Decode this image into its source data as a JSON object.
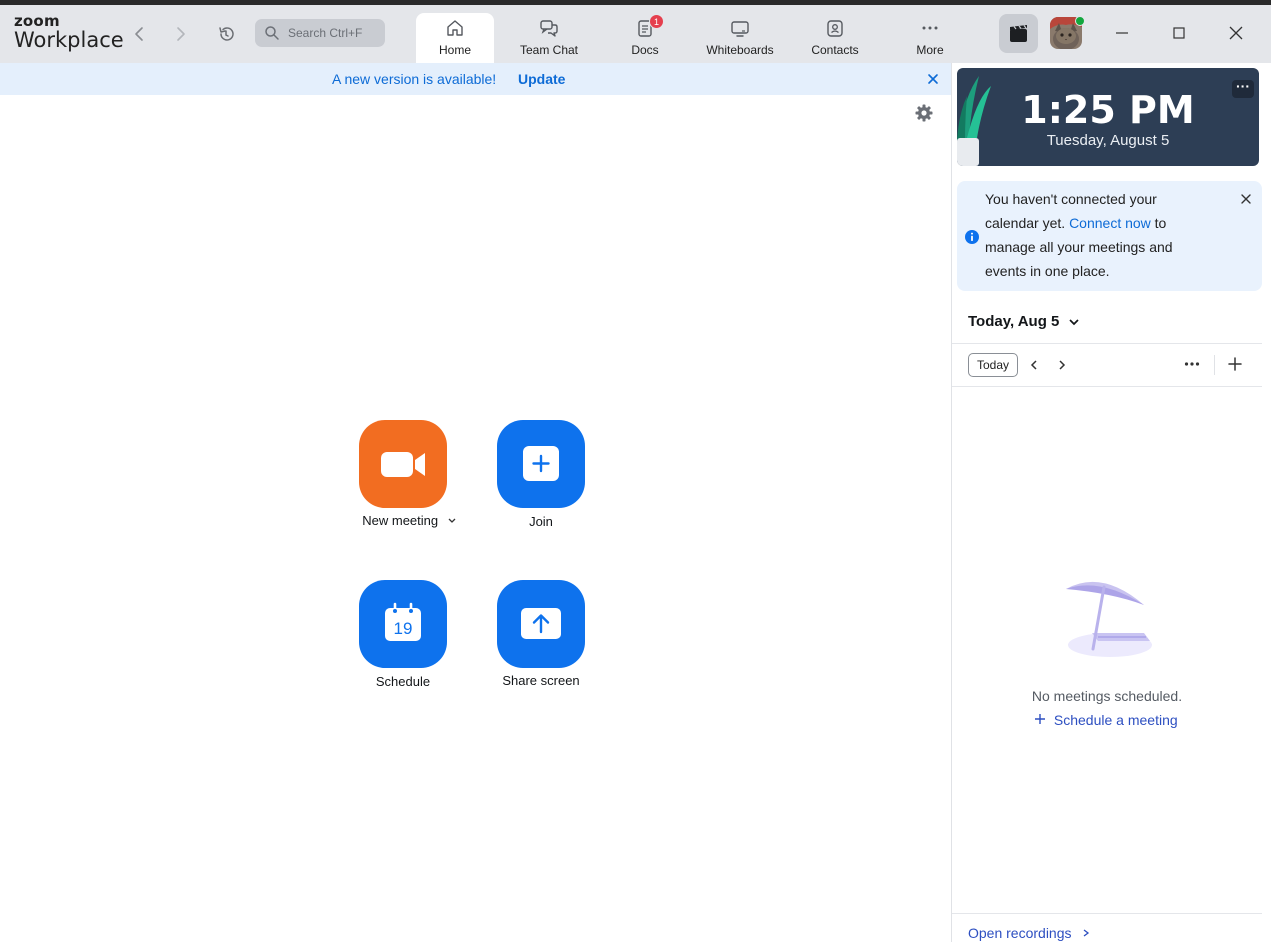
{
  "app": {
    "logo_top": "zoom",
    "logo_bottom": "Workplace"
  },
  "search": {
    "placeholder": "Search Ctrl+F"
  },
  "tabs": [
    {
      "label": "Home",
      "icon": "home-icon",
      "active": true
    },
    {
      "label": "Team Chat",
      "icon": "chat-icon"
    },
    {
      "label": "Docs",
      "icon": "docs-icon",
      "badge": "1"
    },
    {
      "label": "Whiteboards",
      "icon": "whiteboard-icon"
    },
    {
      "label": "Contacts",
      "icon": "contacts-icon"
    },
    {
      "label": "More",
      "icon": "more-icon"
    }
  ],
  "banner": {
    "message": "A new version is available!",
    "action": "Update"
  },
  "actions": {
    "new_meeting": "New meeting",
    "join": "Join",
    "schedule": "Schedule",
    "schedule_day": "19",
    "share_screen": "Share screen"
  },
  "colors": {
    "orange": "#f26d21",
    "blue": "#0e72ed",
    "titlebar": "#e4e6ea",
    "clock_bg": "#2d3e55"
  },
  "clock": {
    "time": "1:25 PM",
    "date": "Tuesday, August 5"
  },
  "calendar_notice": {
    "text_1": "You haven't connected your calendar yet.",
    "link": "Connect now",
    "text_2": "to manage all your meetings and events in one place."
  },
  "calendar": {
    "date_header": "Today, Aug 5",
    "today_button": "Today",
    "empty_text": "No meetings scheduled.",
    "schedule_link": "Schedule a meeting"
  },
  "footer": {
    "open_recordings": "Open recordings"
  }
}
